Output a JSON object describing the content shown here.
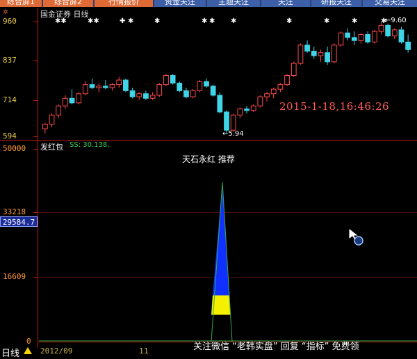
{
  "tabs": [
    {
      "label": "综合屏1",
      "style": "orange"
    },
    {
      "label": "综合屏2",
      "style": "orange"
    },
    {
      "label": "行情报价",
      "style": "orange"
    },
    {
      "label": "资金关注",
      "style": "blue"
    },
    {
      "label": "主题关注",
      "style": "blue"
    },
    {
      "label": "关注",
      "style": "blue"
    },
    {
      "label": "研报关注",
      "style": "blue"
    },
    {
      "label": "交易关注",
      "style": "blue"
    }
  ],
  "header": {
    "stock": "国金证券",
    "period": "日线"
  },
  "price_axis": [
    "960",
    "837",
    "714",
    "594"
  ],
  "indicator_axis": [
    "50000",
    "33218",
    "16609",
    "0"
  ],
  "current_value": "29584.7",
  "markers": {
    "high": "←9.60",
    "low": "←5.94"
  },
  "timestamp": "2015-1-18,16:46:26",
  "indicator": {
    "name": "发红包",
    "ss": "SS: 30.138,"
  },
  "indicator_title": "天石永红 推荐",
  "bottom": {
    "period": "日线",
    "date": "2012/09",
    "mid": "11"
  },
  "watermark": "关注微信 “老韩实盘” 回复 “指标” 免费领",
  "colors": {
    "up": "#ff4a4a",
    "down": "#3fd4e6",
    "fill_top": "#1030ff",
    "fill_bottom": "#f5ef00",
    "axis": "#c01818"
  },
  "chart_data": {
    "type": "candlestick",
    "y_range": [
      5.94,
      9.6
    ],
    "candles": [
      {
        "o": 6.1,
        "h": 6.3,
        "l": 5.95,
        "c": 6.25
      },
      {
        "o": 6.25,
        "h": 6.6,
        "l": 6.15,
        "c": 6.55
      },
      {
        "o": 6.55,
        "h": 6.9,
        "l": 6.45,
        "c": 6.85
      },
      {
        "o": 6.85,
        "h": 7.2,
        "l": 6.75,
        "c": 7.1
      },
      {
        "o": 7.1,
        "h": 7.4,
        "l": 6.9,
        "c": 6.95
      },
      {
        "o": 6.95,
        "h": 7.3,
        "l": 6.9,
        "c": 7.25
      },
      {
        "o": 7.25,
        "h": 7.65,
        "l": 7.2,
        "c": 7.55
      },
      {
        "o": 7.55,
        "h": 7.75,
        "l": 7.4,
        "c": 7.45
      },
      {
        "o": 7.45,
        "h": 7.6,
        "l": 7.3,
        "c": 7.5
      },
      {
        "o": 7.5,
        "h": 7.7,
        "l": 7.4,
        "c": 7.45
      },
      {
        "o": 7.45,
        "h": 7.6,
        "l": 7.35,
        "c": 7.55
      },
      {
        "o": 7.55,
        "h": 7.8,
        "l": 7.45,
        "c": 7.7
      },
      {
        "o": 7.7,
        "h": 7.75,
        "l": 7.3,
        "c": 7.35
      },
      {
        "o": 7.35,
        "h": 7.45,
        "l": 7.1,
        "c": 7.15
      },
      {
        "o": 7.15,
        "h": 7.3,
        "l": 7.05,
        "c": 7.25
      },
      {
        "o": 7.25,
        "h": 7.35,
        "l": 7.05,
        "c": 7.1
      },
      {
        "o": 7.1,
        "h": 7.3,
        "l": 7.05,
        "c": 7.2
      },
      {
        "o": 7.2,
        "h": 7.6,
        "l": 7.15,
        "c": 7.55
      },
      {
        "o": 7.55,
        "h": 7.9,
        "l": 7.5,
        "c": 7.85
      },
      {
        "o": 7.85,
        "h": 7.9,
        "l": 7.55,
        "c": 7.6
      },
      {
        "o": 7.6,
        "h": 7.65,
        "l": 7.3,
        "c": 7.35
      },
      {
        "o": 7.35,
        "h": 7.45,
        "l": 7.1,
        "c": 7.15
      },
      {
        "o": 7.15,
        "h": 7.4,
        "l": 7.1,
        "c": 7.35
      },
      {
        "o": 7.35,
        "h": 7.7,
        "l": 7.3,
        "c": 7.65
      },
      {
        "o": 7.65,
        "h": 7.75,
        "l": 7.45,
        "c": 7.5
      },
      {
        "o": 7.5,
        "h": 7.55,
        "l": 7.15,
        "c": 7.2
      },
      {
        "o": 7.2,
        "h": 7.3,
        "l": 6.6,
        "c": 6.65
      },
      {
        "o": 6.65,
        "h": 6.7,
        "l": 5.94,
        "c": 6.05
      },
      {
        "o": 6.05,
        "h": 6.6,
        "l": 6.0,
        "c": 6.55
      },
      {
        "o": 6.55,
        "h": 6.8,
        "l": 6.45,
        "c": 6.75
      },
      {
        "o": 6.75,
        "h": 6.85,
        "l": 6.6,
        "c": 6.7
      },
      {
        "o": 6.7,
        "h": 6.9,
        "l": 6.65,
        "c": 6.85
      },
      {
        "o": 6.85,
        "h": 7.2,
        "l": 6.8,
        "c": 7.15
      },
      {
        "o": 7.15,
        "h": 7.3,
        "l": 7.0,
        "c": 7.25
      },
      {
        "o": 7.25,
        "h": 7.45,
        "l": 7.1,
        "c": 7.4
      },
      {
        "o": 7.4,
        "h": 7.6,
        "l": 7.3,
        "c": 7.55
      },
      {
        "o": 7.55,
        "h": 7.9,
        "l": 7.5,
        "c": 7.85
      },
      {
        "o": 7.85,
        "h": 8.3,
        "l": 7.8,
        "c": 8.25
      },
      {
        "o": 8.25,
        "h": 8.9,
        "l": 8.2,
        "c": 8.85
      },
      {
        "o": 8.85,
        "h": 9.0,
        "l": 8.6,
        "c": 8.65
      },
      {
        "o": 8.65,
        "h": 8.8,
        "l": 8.4,
        "c": 8.5
      },
      {
        "o": 8.5,
        "h": 8.7,
        "l": 8.3,
        "c": 8.6
      },
      {
        "o": 8.6,
        "h": 8.8,
        "l": 8.2,
        "c": 8.3
      },
      {
        "o": 8.3,
        "h": 8.9,
        "l": 8.25,
        "c": 8.85
      },
      {
        "o": 8.85,
        "h": 9.3,
        "l": 8.8,
        "c": 9.25
      },
      {
        "o": 9.25,
        "h": 9.4,
        "l": 9.0,
        "c": 9.1
      },
      {
        "o": 9.1,
        "h": 9.3,
        "l": 8.85,
        "c": 9.0
      },
      {
        "o": 9.0,
        "h": 9.25,
        "l": 8.9,
        "c": 9.2
      },
      {
        "o": 9.2,
        "h": 9.3,
        "l": 8.9,
        "c": 8.95
      },
      {
        "o": 8.95,
        "h": 9.35,
        "l": 8.9,
        "c": 9.3
      },
      {
        "o": 9.3,
        "h": 9.6,
        "l": 9.2,
        "c": 9.5
      },
      {
        "o": 9.5,
        "h": 9.55,
        "l": 9.1,
        "c": 9.15
      },
      {
        "o": 9.15,
        "h": 9.4,
        "l": 9.05,
        "c": 9.35
      },
      {
        "o": 9.35,
        "h": 9.45,
        "l": 8.9,
        "c": 8.95
      },
      {
        "o": 8.95,
        "h": 9.2,
        "l": 8.6,
        "c": 8.7
      }
    ],
    "indicator": {
      "peak_value": 50000,
      "yellow_top": 12000
    }
  }
}
